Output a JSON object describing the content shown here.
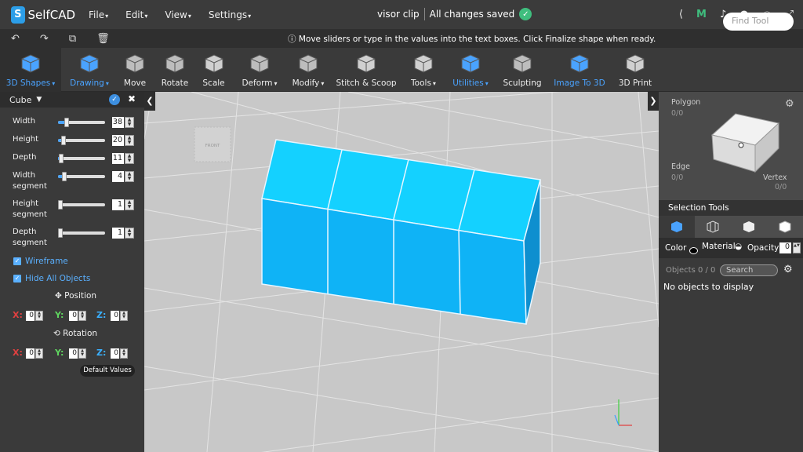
{
  "app": {
    "logo_text": "SelfCAD",
    "logo_letter": "S"
  },
  "menu": [
    "File",
    "Edit",
    "View",
    "Settings"
  ],
  "project": {
    "name": "visor clip",
    "status": "All changes saved"
  },
  "hint": "Move sliders or type in the values into the text boxes. Click Finalize shape when ready.",
  "toolbar": [
    {
      "label": "3D Shapes",
      "dropdown": true,
      "blue": true,
      "active": true,
      "icon": "cube-icon"
    },
    {
      "label": "Drawing",
      "dropdown": true,
      "blue": true,
      "icon": "drawing-icon"
    },
    {
      "label": "Move",
      "icon": "move-icon"
    },
    {
      "label": "Rotate",
      "icon": "rotate-icon"
    },
    {
      "label": "Scale",
      "icon": "scale-icon"
    },
    {
      "label": "Deform",
      "dropdown": true,
      "icon": "deform-icon"
    },
    {
      "label": "Modify",
      "dropdown": true,
      "icon": "modify-icon"
    },
    {
      "label": "Stitch & Scoop",
      "icon": "stitch-scoop-icon"
    },
    {
      "label": "Tools",
      "dropdown": true,
      "icon": "tools-icon"
    },
    {
      "label": "Utilities",
      "dropdown": true,
      "blue": true,
      "icon": "utilities-icon"
    },
    {
      "label": "Sculpting",
      "icon": "sculpting-icon"
    },
    {
      "label": "Image To 3D",
      "blue": true,
      "icon": "image-to-3d-icon"
    },
    {
      "label": "3D Print",
      "icon": "3d-print-icon"
    }
  ],
  "find_tool": {
    "placeholder": "Find Tool"
  },
  "panel": {
    "shape": "Cube",
    "params": [
      {
        "label": "Width",
        "value": "38",
        "fraction": 0.15
      },
      {
        "label": "Height",
        "value": "20",
        "fraction": 0.07
      },
      {
        "label": "Depth",
        "value": "11",
        "fraction": 0.02
      },
      {
        "label": "Width\nsegment",
        "value": "4",
        "fraction": 0.1
      },
      {
        "label": "Height\nsegment",
        "value": "1",
        "fraction": 0.0
      },
      {
        "label": "Depth\nsegment",
        "value": "1",
        "fraction": 0.0
      }
    ],
    "wireframe": "Wireframe",
    "hide_all": "Hide All Objects",
    "position_label": "Position",
    "rotation_label": "Rotation",
    "position": {
      "x": "0",
      "y": "0",
      "z": "0"
    },
    "rotation": {
      "x": "0",
      "y": "0",
      "z": "0"
    },
    "axis": {
      "x": "X:",
      "y": "Y:",
      "z": "Z:"
    },
    "default_values": "Default Values"
  },
  "viewcube": {
    "front": "FRONT"
  },
  "right": {
    "polygon": "Polygon",
    "polygon_count": "0/0",
    "edge": "Edge",
    "edge_count": "0/0",
    "vertex": "Vertex",
    "vertex_count": "0/0",
    "selection_tools": "Selection Tools",
    "color": "Color",
    "material": "Material",
    "opacity": "Opacity",
    "opacity_value": "0",
    "objects": "Objects 0 / 0",
    "search_placeholder": "Search",
    "empty": "No objects to display"
  },
  "colors": {
    "accent": "#4aa3ff",
    "object": "#12b0f5",
    "object_top": "#15d2ff",
    "saved": "#3fbe7e"
  }
}
